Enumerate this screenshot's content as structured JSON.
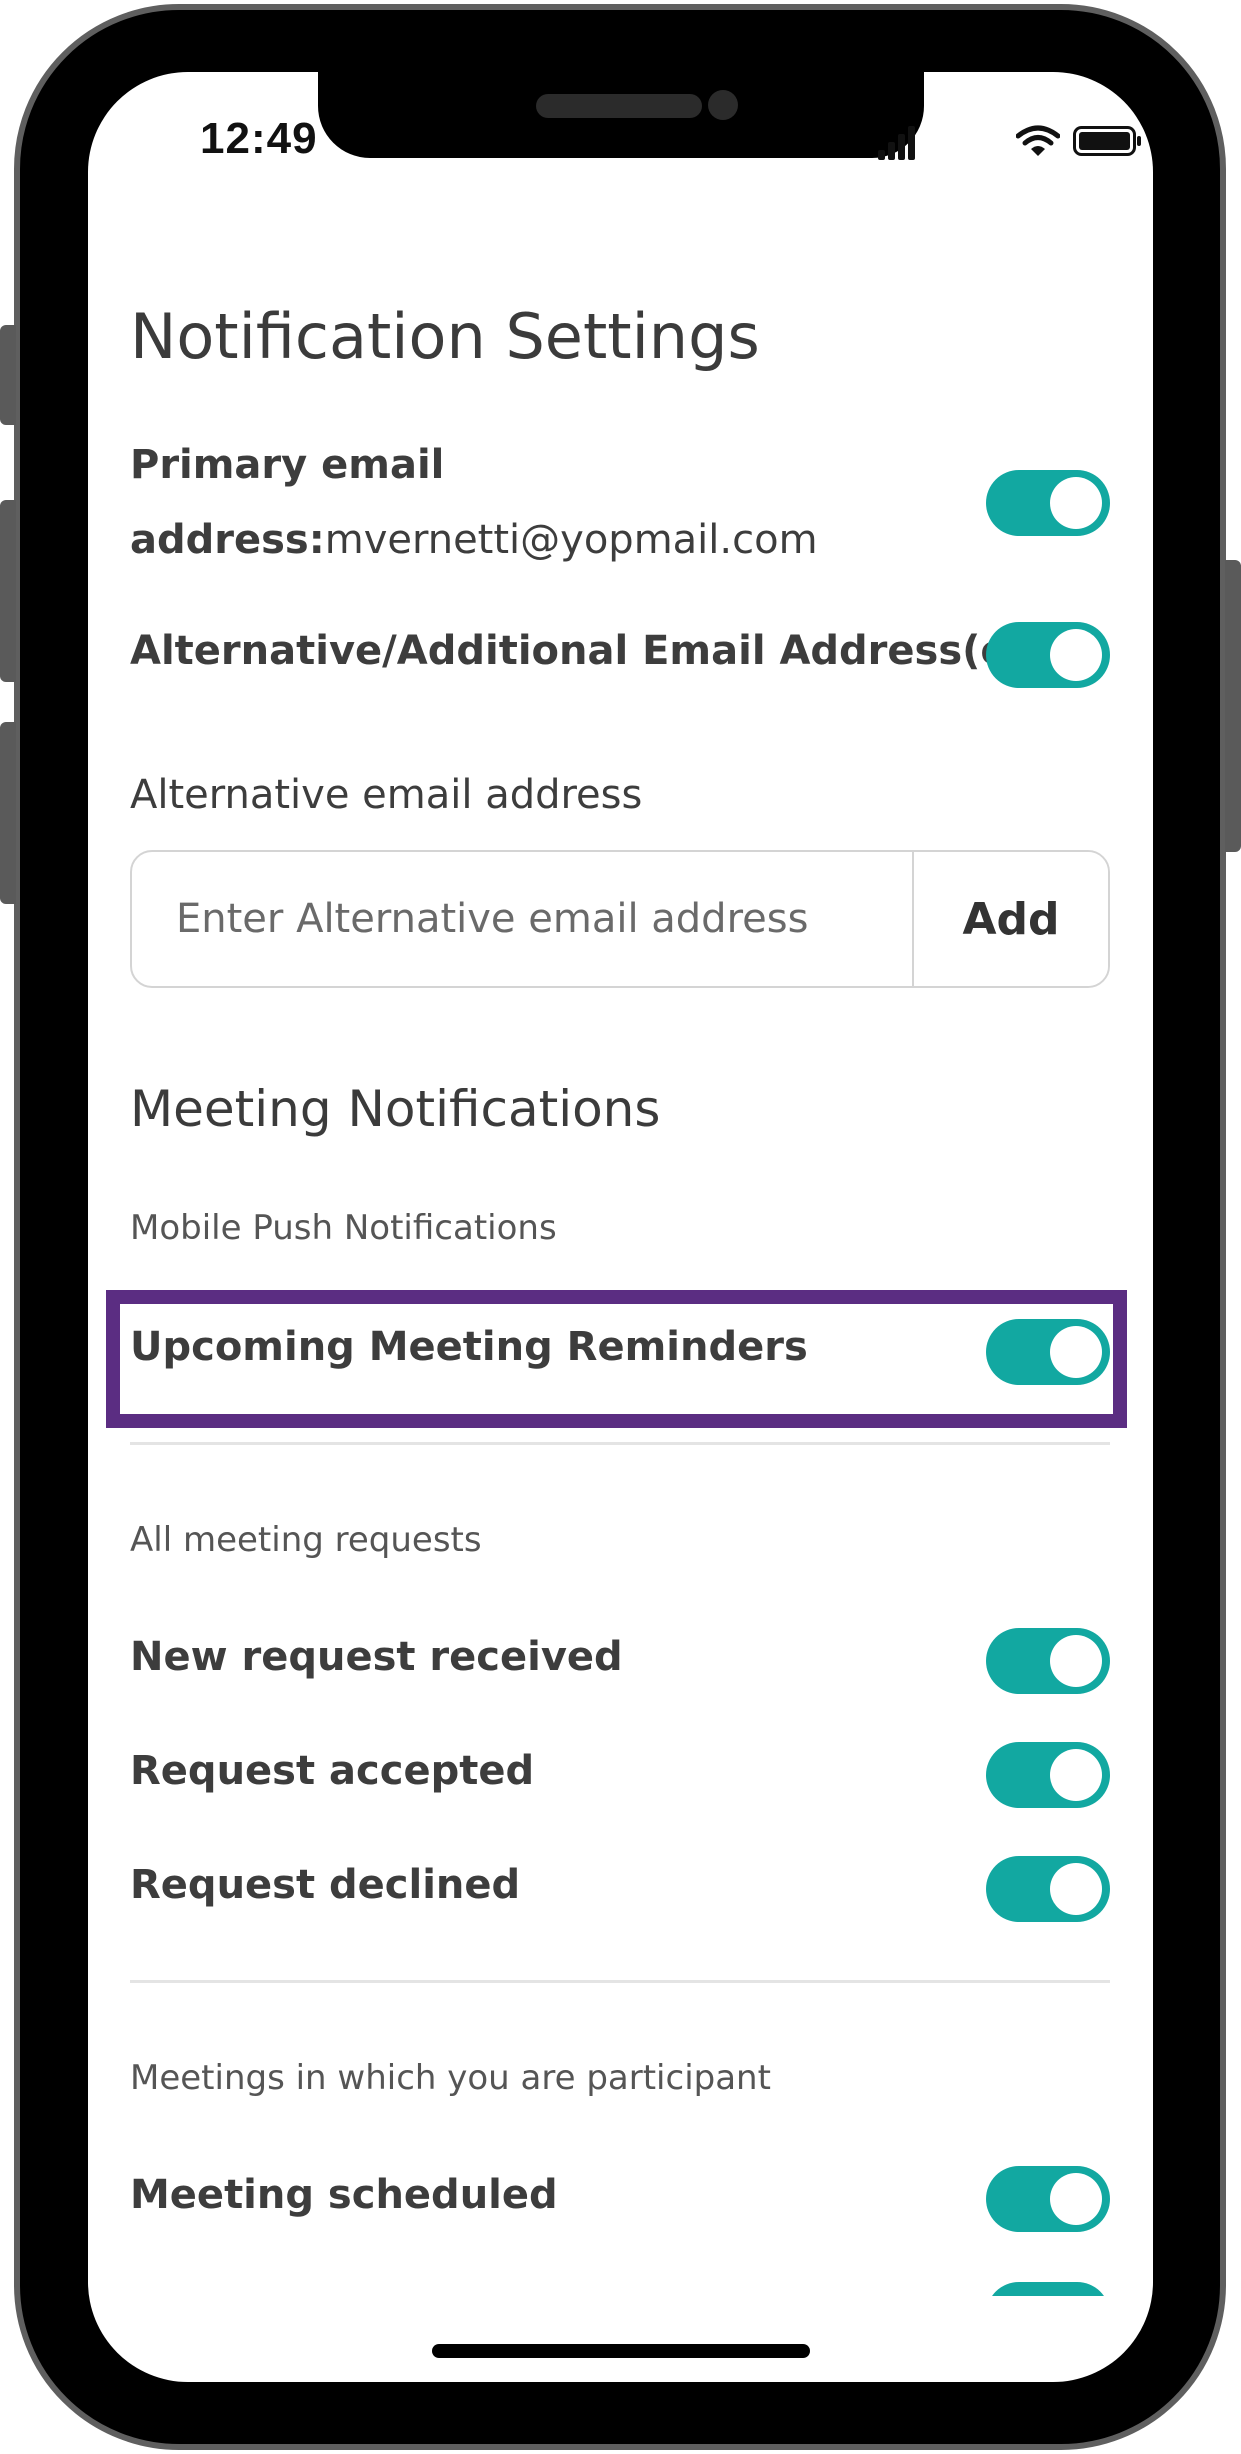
{
  "status_bar": {
    "time": "12:49"
  },
  "page": {
    "title": "Notification Settings"
  },
  "primary_email": {
    "label_line1": "Primary email",
    "label_prefix": "address:",
    "email": "mvernetti@yopmail.com",
    "enabled": true
  },
  "alternative_toggle": {
    "label": "Alternative/Additional Email Address(es)",
    "enabled": true
  },
  "alternative_input": {
    "label": "Alternative email address",
    "placeholder": "Enter Alternative email address",
    "add_label": "Add"
  },
  "meeting_notifications": {
    "title": "Meeting Notifications",
    "push_caption": "Mobile Push Notifications",
    "upcoming_reminders": {
      "label": "Upcoming Meeting Reminders",
      "enabled": true
    }
  },
  "all_requests": {
    "caption": "All meeting requests",
    "items": [
      {
        "label": "New request received",
        "enabled": true
      },
      {
        "label": "Request accepted",
        "enabled": true
      },
      {
        "label": "Request declined",
        "enabled": true
      }
    ]
  },
  "participant": {
    "caption": "Meetings in which you are participant",
    "items": [
      {
        "label": "Meeting scheduled",
        "enabled": true
      }
    ]
  },
  "colors": {
    "toggle_on": "#12a8a1",
    "highlight": "#5b2d82"
  }
}
